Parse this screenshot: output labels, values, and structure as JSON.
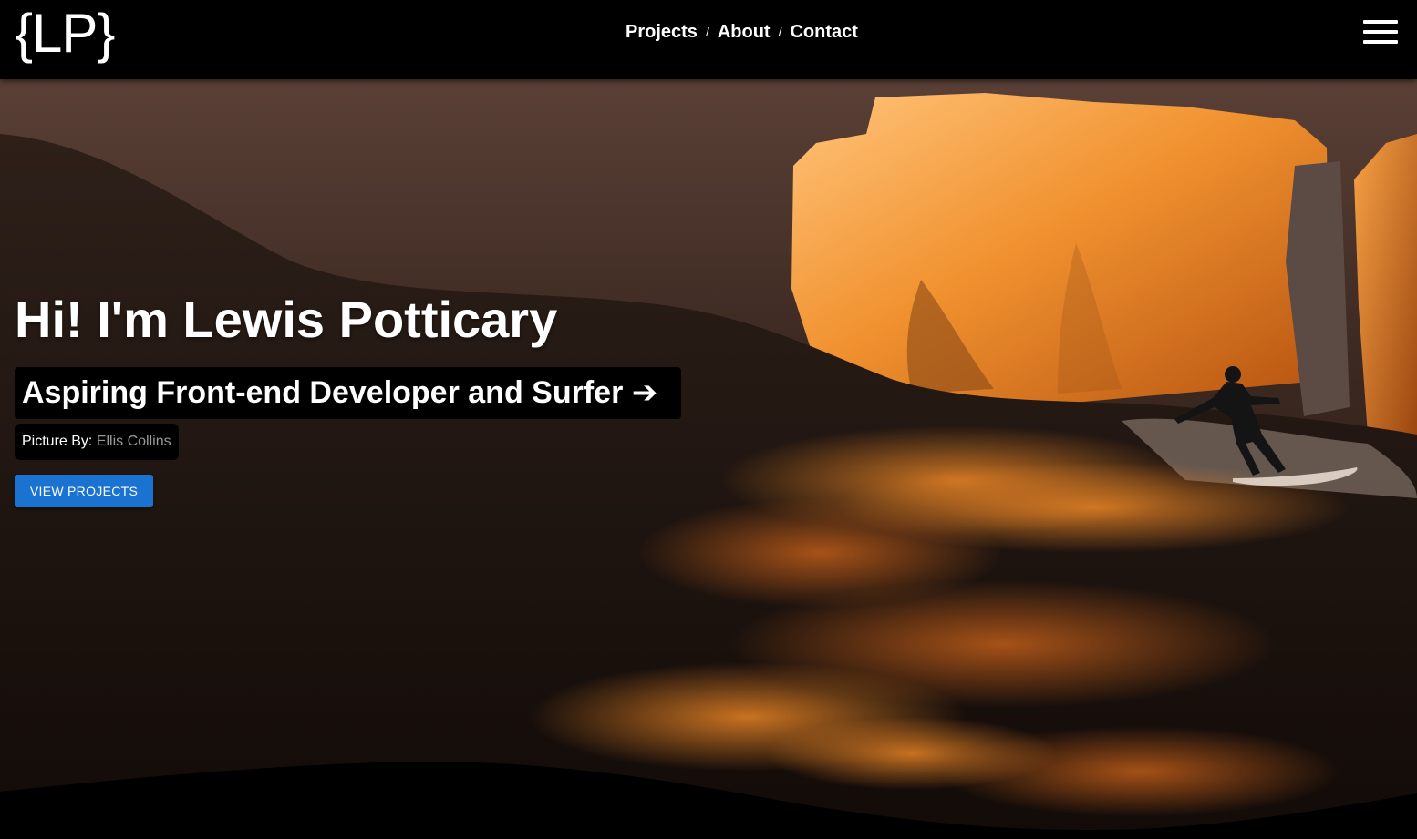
{
  "header": {
    "logo": "{LP}",
    "nav": [
      {
        "label": "Projects"
      },
      {
        "label": "About"
      },
      {
        "label": "Contact"
      }
    ],
    "separator": "/",
    "menu_icon": "hamburger-menu-icon"
  },
  "hero": {
    "title": "Hi! I'm Lewis Potticary",
    "subtitle": "Aspiring Front-end Developer and Surfer ➔",
    "credit_label": "Picture By:",
    "credit_name": "Ellis Collins",
    "cta_label": "VIEW PROJECTS"
  },
  "colors": {
    "navbar_bg": "#000000",
    "accent_button": "#1a73d0",
    "credit_name": "#9a9a9a",
    "cliff_glow": "#f08a22"
  }
}
